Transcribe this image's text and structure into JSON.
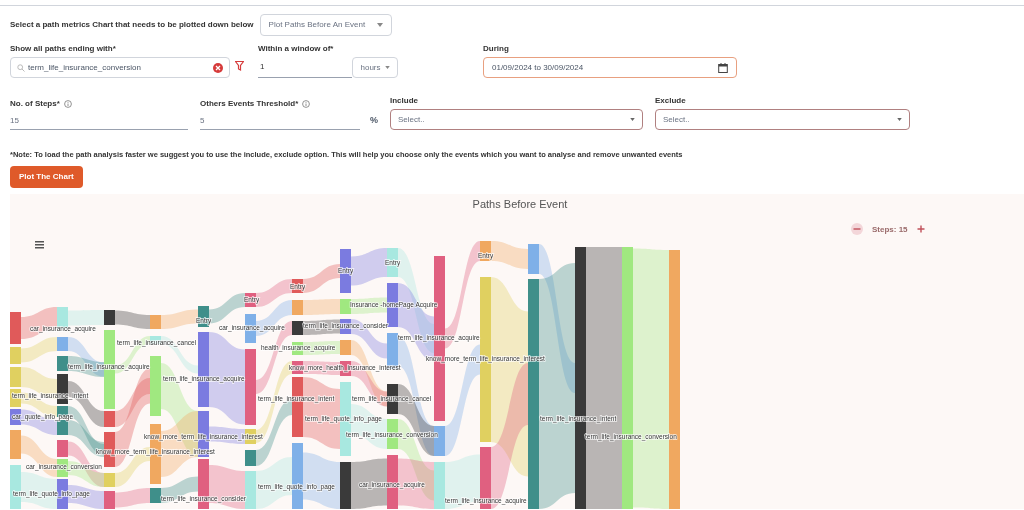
{
  "chart_selector": {
    "label": "Select a path metrics Chart that needs to be plotted down below",
    "value": "Plot Paths Before An Event"
  },
  "paths_ending": {
    "label": "Show all paths ending with*",
    "value": "term_life_insurance_conversion"
  },
  "window": {
    "label": "Within a window of*",
    "value": "1",
    "unit": "hours"
  },
  "during": {
    "label": "During",
    "value": "01/09/2024 to 30/09/2024"
  },
  "steps": {
    "label": "No. of Steps*",
    "value": "15"
  },
  "threshold": {
    "label": "Others Events Threshold*",
    "value": "5",
    "unit": "%"
  },
  "include": {
    "label": "Include",
    "placeholder": "Select.."
  },
  "exclude": {
    "label": "Exclude",
    "placeholder": "Select.."
  },
  "note": "*Note: To load the path analysis faster we suggest you to use the include, exclude option. This will help you choose only the events which you want to analyse and remove unwanted events",
  "plot_button": "Plot The Chart",
  "chart": {
    "title": "Paths Before Event",
    "steps_label": "Steps: 15",
    "labels": [
      "Entry",
      "Entry",
      "Entry",
      "Entry",
      "Entry",
      "Insurance -homePage Acquire",
      "Entry",
      "car_insurance_acquire",
      "car_insurance_acquire",
      "term_life_insurance_consider",
      "term_life_insurance_acquire",
      "term_life_insurance_cancel",
      "health_insurance_acquire",
      "know_more_term_life_insurance_interest",
      "term_life_insurance_acquire",
      "know_more_health_insurance_interest",
      "term_life_insurance_acquire",
      "term_life_insurance_intent",
      "term_life_insurance_intent",
      "term_life_insurance_cancel",
      "car_quote_info_page",
      "term_life_quote_info_page",
      "term_life_insurance_intent",
      "know_more_term_life_insurance_interest",
      "term_life_insurance_conversion",
      "term_life_insurance_conversion",
      "know_more_term_life_insurance_interest",
      "car_insurance_conversion",
      "term_life_quote_info_page",
      "car_insurance_acquire",
      "term_life_quote_info_page",
      "term_life_insurance_consider",
      "term_life_insurance_acquire"
    ]
  }
}
